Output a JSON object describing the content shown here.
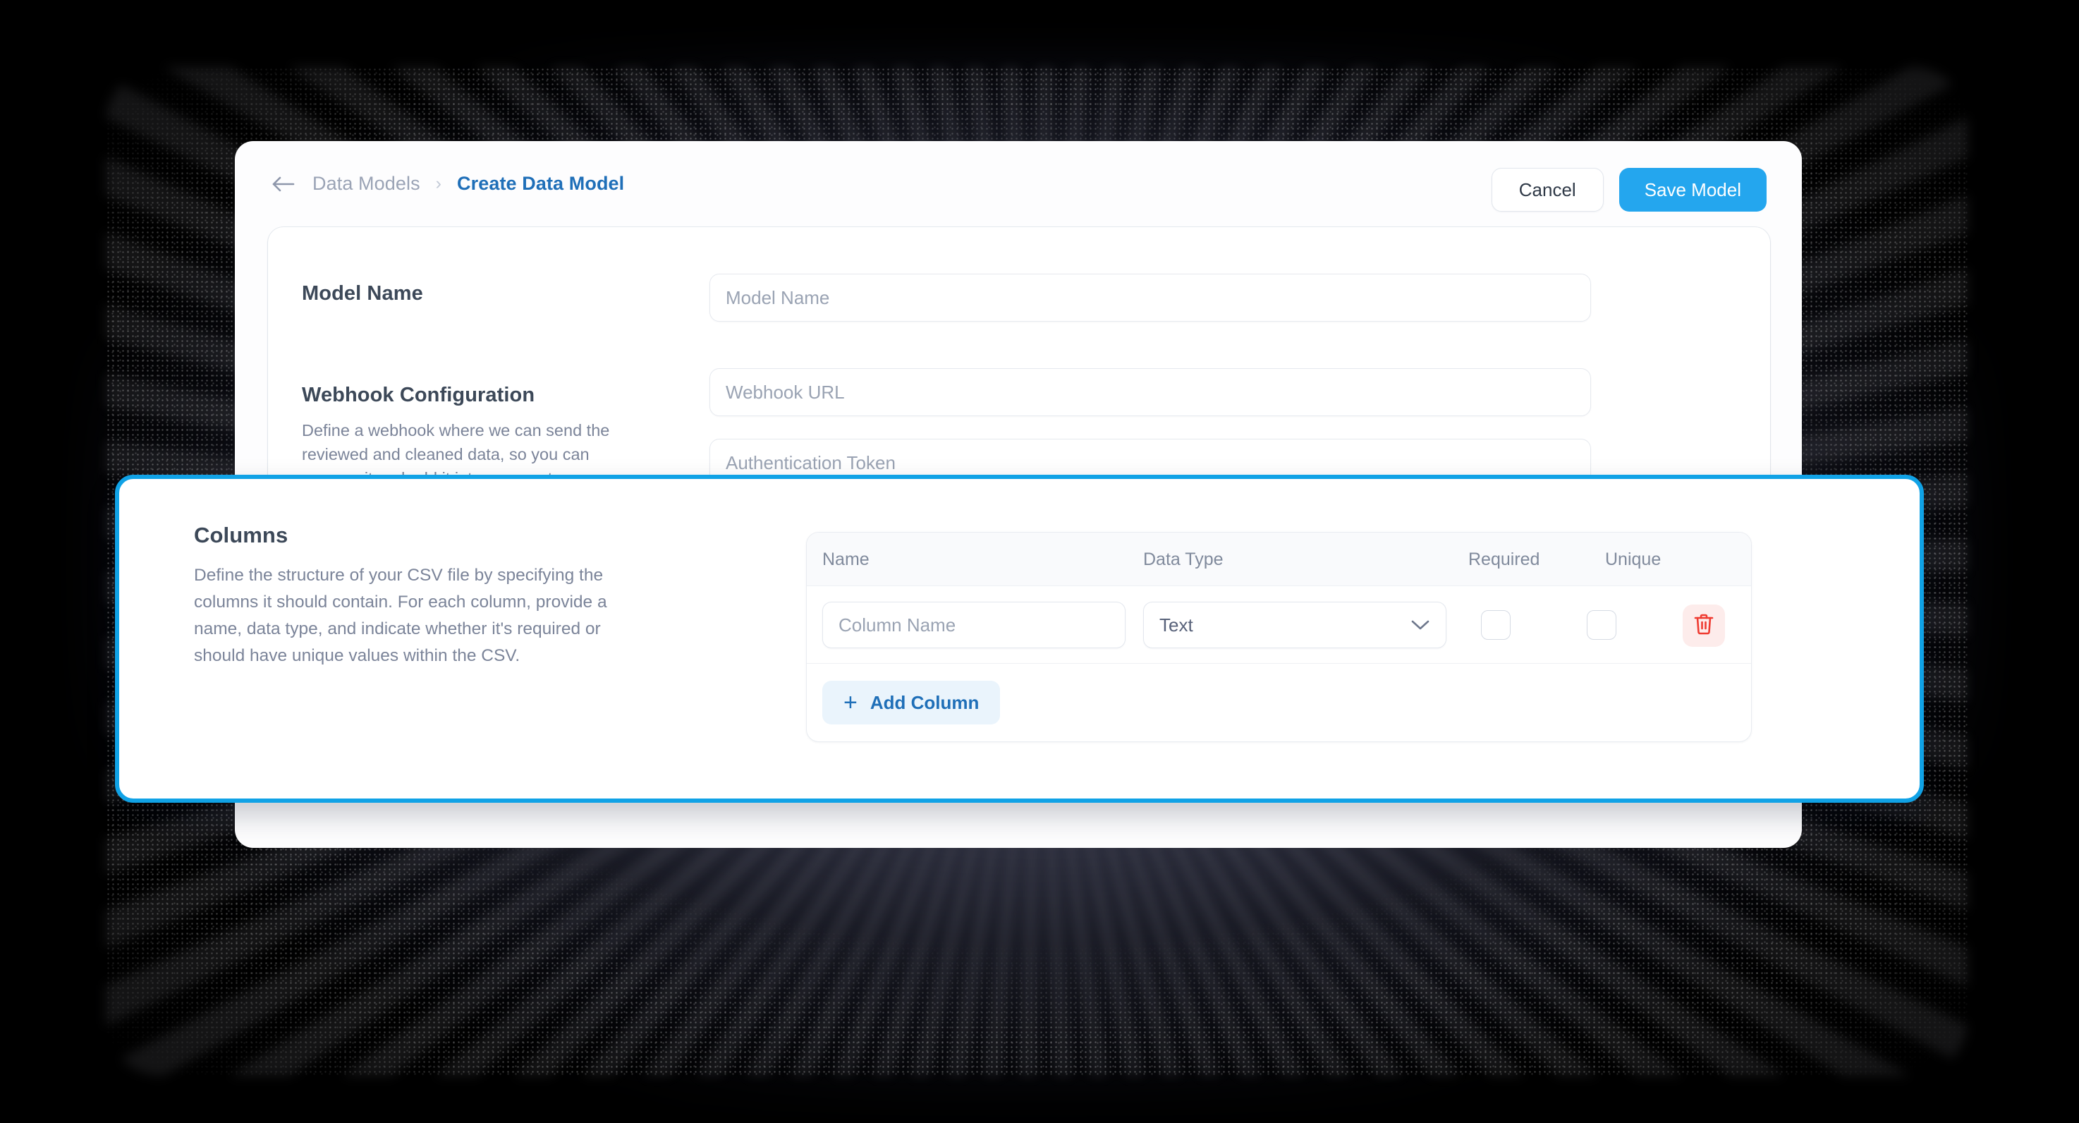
{
  "topbar": {
    "back_icon": "arrow-left-icon",
    "breadcrumb_parent": "Data Models",
    "breadcrumb_separator": "›",
    "breadcrumb_current": "Create Data Model",
    "cancel_label": "Cancel",
    "save_label": "Save Model"
  },
  "form": {
    "model_name": {
      "label": "Model Name",
      "placeholder": "Model Name"
    },
    "webhook": {
      "label": "Webhook Configuration",
      "description": "Define a webhook where we can send the reviewed and cleaned data, so you can process it and add it into your system.",
      "url_placeholder": "Webhook URL",
      "token_placeholder": "Authentication Token"
    }
  },
  "columns": {
    "title": "Columns",
    "description": "Define the structure of your CSV file by specifying the columns it should contain. For each column, provide a name, data type, and indicate whether it's required or should have unique values within the CSV.",
    "table": {
      "headers": [
        "Name",
        "Data Type",
        "Required",
        "Unique"
      ],
      "rows": [
        {
          "name_placeholder": "Column Name",
          "data_type": "Text",
          "required": false,
          "unique": false,
          "delete_icon": "trash-icon"
        }
      ],
      "add_label": "Add Column",
      "add_icon": "plus-icon"
    }
  },
  "colors": {
    "accent_blue": "#24a6ee",
    "highlight_border": "#10a2e6",
    "link_blue": "#1f6fb8",
    "danger_red": "#ef3b31"
  }
}
